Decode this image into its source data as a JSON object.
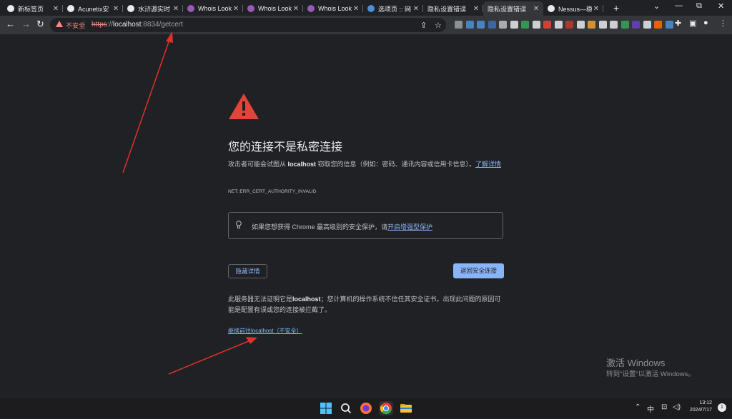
{
  "tabs": [
    {
      "label": "新标签页",
      "fav_color": "#e8eaed",
      "active": false
    },
    {
      "label": "Acunetix安",
      "fav_color": "#e8eaed",
      "active": false
    },
    {
      "label": "水浒源实时",
      "fav_color": "#e8eaed",
      "active": false
    },
    {
      "label": "Whois Look",
      "fav_color": "#9b59b6",
      "active": false
    },
    {
      "label": "Whois Look",
      "fav_color": "#9b59b6",
      "active": false
    },
    {
      "label": "Whois Look",
      "fav_color": "#9b59b6",
      "active": false
    },
    {
      "label": "选项页 :: 网",
      "fav_color": "#4a90d9",
      "active": false
    },
    {
      "label": "隐私设置错误",
      "fav_color": "",
      "active": false
    },
    {
      "label": "隐私设置错误",
      "fav_color": "",
      "active": true
    },
    {
      "label": "Nessus—稳",
      "fav_color": "#e8eaed",
      "active": false
    }
  ],
  "toolbar": {
    "not_secure": "不安全",
    "url_scheme": "https",
    "url_sep": "://",
    "url_host": "localhost",
    "url_rest": ":8834/getcert",
    "ext_colors": [
      "#9aa0a6",
      "#4a90d9",
      "#4a90d9",
      "#3c6fb0",
      "#c0c0c0",
      "#e8eaed",
      "#34a853",
      "#e8eaed",
      "#ea4335",
      "#e8eaed",
      "#c0392b",
      "#e8eaed",
      "#f0a030",
      "#e8eaed",
      "#e8eaed",
      "#34a853",
      "#6a3fbf",
      "#e8eaed",
      "#ff6d00",
      "#4a90d9"
    ]
  },
  "page": {
    "heading": "您的连接不是私密连接",
    "para1_prefix": "攻击者可能会试图从 ",
    "para1_host": "localhost",
    "para1_suffix": " 窃取您的信息（例如：密码、通讯内容或信用卡信息）。",
    "learn_more": "了解详情",
    "error_code": "NET::ERR_CERT_AUTHORITY_INVALID",
    "protection_prefix": "如果您想获得 Chrome 最高级别的安全保护，请",
    "protection_link": "开启增强型保护",
    "details_button": "隐藏详情",
    "back_button": "返回安全连接",
    "para2_prefix": "此服务器无法证明它是",
    "para2_host": "localhost",
    "para2_suffix": "；您计算机的操作系统不信任其安全证书。出现此问题的原因可能是配置有误或您的连接被拦截了。",
    "proceed_link": "继续前往localhost（不安全）"
  },
  "watermark": {
    "line1": "激活 Windows",
    "line2": "转到\"设置\"以激活 Windows。"
  },
  "taskbar": {
    "ime": "中",
    "time": "13:12",
    "date": "2024/7/17",
    "notification_count": "1"
  }
}
